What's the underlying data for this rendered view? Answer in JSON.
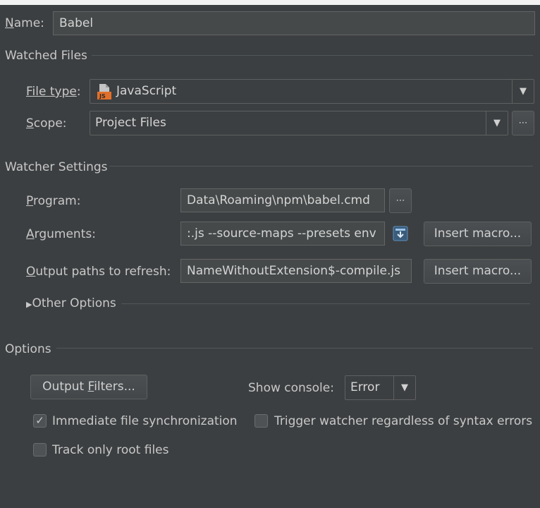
{
  "name": {
    "label": "Name:",
    "mnemonic": "N",
    "label_rest": "ame:",
    "value": "Babel"
  },
  "watched_files": {
    "title": "Watched Files",
    "file_type": {
      "mnemonic": "File type",
      "label_rest": ":",
      "value": "JavaScript",
      "icon": "javascript-file-icon"
    },
    "scope": {
      "mnemonic": "S",
      "label_rest": "cope:",
      "value": "Project Files",
      "more": "⋯"
    }
  },
  "watcher_settings": {
    "title": "Watcher Settings",
    "program": {
      "mnemonic": "P",
      "label_rest": "rogram:",
      "value": "Data\\Roaming\\npm\\babel.cmd",
      "more": "⋯"
    },
    "arguments": {
      "mnemonic": "A",
      "label_rest": "rguments:",
      "value": ":.js --source-maps --presets env",
      "insert_macro": "Insert macro..."
    },
    "output_paths": {
      "mnemonic": "O",
      "label_rest": "utput paths to refresh:",
      "value": "NameWithoutExtension$-compile.js",
      "insert_macro": "Insert macro..."
    },
    "other_options": "Other Options"
  },
  "options": {
    "title": "Options",
    "output_filters": {
      "before": "Output ",
      "mnemonic": "F",
      "after": "ilters..."
    },
    "show_console": {
      "label": "Show console:",
      "value": "Error"
    },
    "immediate_sync": {
      "label": "Immediate file synchronization",
      "checked": true
    },
    "trigger_watcher": {
      "label": "Trigger watcher regardless of syntax errors",
      "checked": false
    },
    "track_root": {
      "label": "Track only root files",
      "checked": false
    }
  },
  "colors": {
    "background": "#3c3f41",
    "field": "#45494a",
    "text": "#c8c8c8",
    "js_icon": "#e2702a"
  }
}
